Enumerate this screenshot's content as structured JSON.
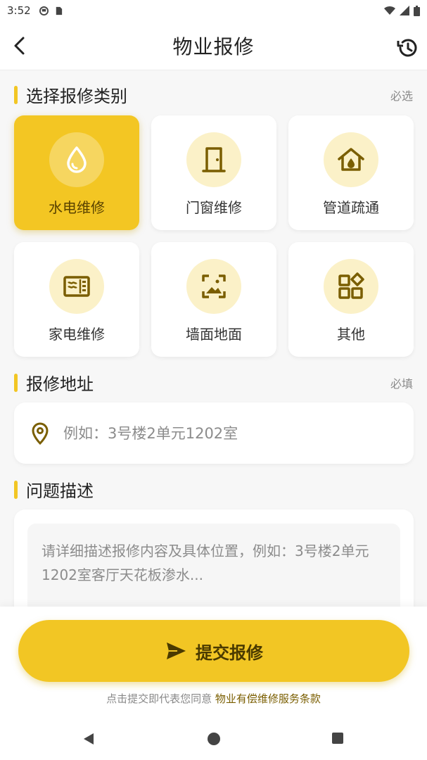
{
  "status_bar": {
    "time": "3:52",
    "icons": [
      "app-icon",
      "sd-card-icon",
      "wifi-icon",
      "signal-icon",
      "battery-icon"
    ]
  },
  "header": {
    "title": "物业报修",
    "back_icon": "chevron-left-icon",
    "history_icon": "history-icon"
  },
  "category": {
    "label": "选择报修类别",
    "hint": "必选",
    "items": [
      {
        "label": "水电维修",
        "icon": "water-drop-icon",
        "selected": true
      },
      {
        "label": "门窗维修",
        "icon": "door-icon",
        "selected": false
      },
      {
        "label": "管道疏通",
        "icon": "house-icon",
        "selected": false
      },
      {
        "label": "家电维修",
        "icon": "appliance-icon",
        "selected": false
      },
      {
        "label": "墙面地面",
        "icon": "wall-image-icon",
        "selected": false
      },
      {
        "label": "其他",
        "icon": "widgets-icon",
        "selected": false
      }
    ]
  },
  "address": {
    "label": "报修地址",
    "hint": "必填",
    "placeholder": "例如：3号楼2单元1202室",
    "value": ""
  },
  "description": {
    "label": "问题描述",
    "placeholder": "请详细描述报修内容及具体位置，例如：3号楼2单元1202室客厅天花板渗水...",
    "value": ""
  },
  "submit": {
    "label": "提交报修",
    "icon": "send-icon"
  },
  "terms": {
    "prefix": "点击提交即代表您同意 ",
    "link": "物业有偿维修服务条款"
  },
  "colors": {
    "accent": "#f2c624",
    "icon": "#7a5e00",
    "icon_bg": "#fbf1c8"
  }
}
